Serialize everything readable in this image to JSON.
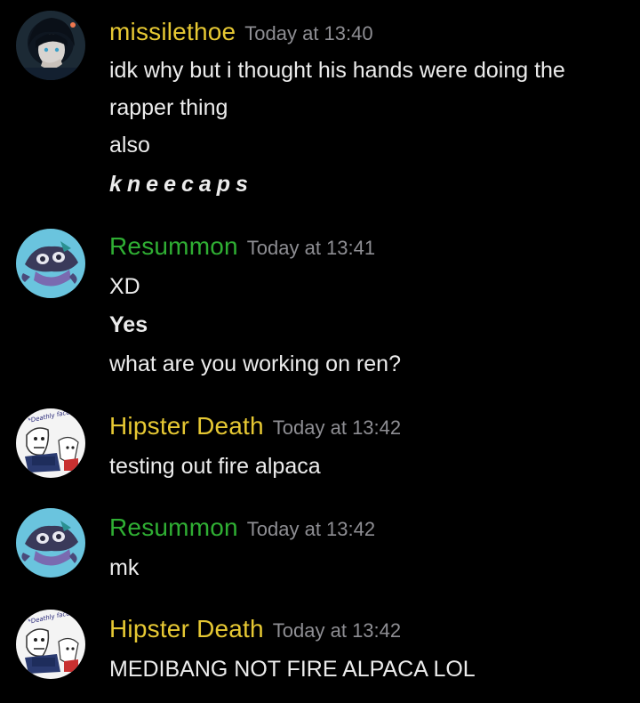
{
  "colors": {
    "background": "#000000",
    "missilethoe": "#e6c833",
    "resummon": "#2fae33",
    "hipster_death": "#e6c833",
    "timestamp": "#8e8e93",
    "message_text": "#ececec"
  },
  "messages": [
    {
      "username": "missilethoe",
      "timestamp": "Today at 13:40",
      "avatar_icon": "dark-haired-character-avatar",
      "lines": [
        "idk why but i thought his hands were doing the",
        "rapper thing",
        "also",
        "kneecaps"
      ]
    },
    {
      "username": "Resummon",
      "timestamp": "Today at 13:41",
      "avatar_icon": "teal-creature-avatar",
      "lines": [
        "XD",
        "Yes",
        "what are you working on ren?"
      ]
    },
    {
      "username": "Hipster Death",
      "timestamp": "Today at 13:42",
      "avatar_icon": "sketch-skeleton-avatar",
      "avatar_text": "*Deathly face touch*",
      "lines": [
        "testing out fire alpaca"
      ]
    },
    {
      "username": "Resummon",
      "timestamp": "Today at 13:42",
      "avatar_icon": "teal-creature-avatar",
      "lines": [
        "mk"
      ]
    },
    {
      "username": "Hipster Death",
      "timestamp": "Today at 13:42",
      "avatar_icon": "sketch-skeleton-avatar",
      "avatar_text": "*Deathly face touch*",
      "lines": [
        "MEDIBANG NOT FIRE ALPACA LOL"
      ]
    }
  ]
}
